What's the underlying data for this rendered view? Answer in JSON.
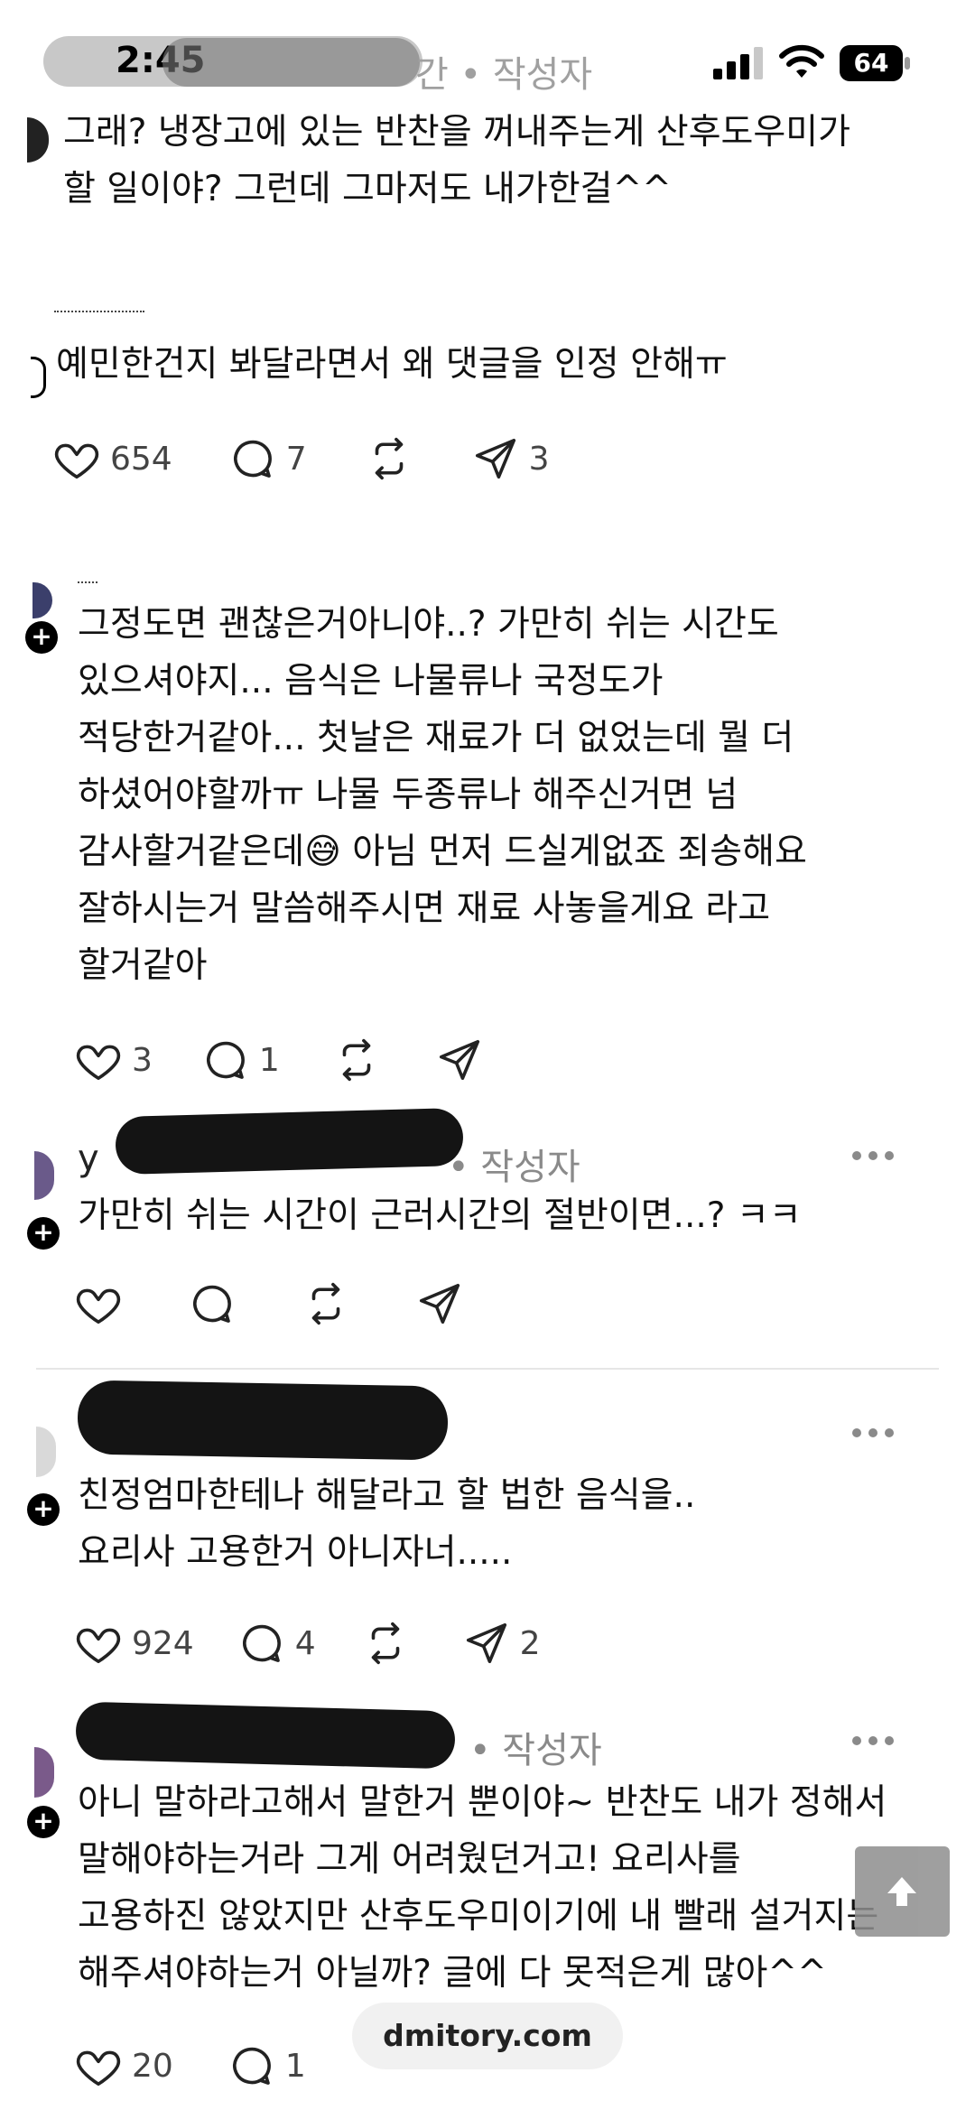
{
  "status_bar": {
    "time": "2:45",
    "battery": "64"
  },
  "comments": [
    {
      "meta_tail": "간 • 작성자",
      "lines": [
        "그래? 냉장고에 있는 반찬을 꺼내주는게 산후도우미가",
        "할 일이야? 그런데 그마저도 내가한걸^^"
      ]
    },
    {
      "lines": [
        "예민한건지 봐달라면서 왜 댓글을 인정 안해ㅠ"
      ],
      "likes": "654",
      "replies": "7",
      "shares": "3"
    },
    {
      "lines": [
        "그정도면 괜찮은거아니야..? 가만히 쉬는 시간도",
        "있으셔야지... 음식은 나물류나 국정도가",
        "적당한거같아... 첫날은 재료가 더 없었는데 뭘 더",
        "하셨어야할까ㅠ 나물 두종류나 해주신거면 넘",
        "감사할거같은데😅 아님 먼저 드실게없죠 죄송해요",
        "잘하시는거 말씀해주시면 재료 사놓을게요 라고",
        "할거같아"
      ],
      "likes": "3",
      "replies": "1"
    },
    {
      "author_visible": "y",
      "meta_tail": "• 작성자",
      "lines": [
        "가만히 쉬는 시간이 근러시간의 절반이면...? ㅋㅋ"
      ]
    },
    {
      "lines": [
        "친정엄마한테나 해달라고 할 법한 음식을..",
        "요리사 고용한거 아니자너....."
      ],
      "likes": "924",
      "replies": "4",
      "shares": "2"
    },
    {
      "meta_tail": "• 작성자",
      "lines": [
        "아니 말하라고해서 말한거 뿐이야~ 반찬도 내가 정해서",
        "말해야하는거라 그게 어려웠던거고! 요리사를",
        "고용하진 않았지만 산후도우미이기에 내 빨래 설거지는",
        "해주셔야하는거 아닐까? 글에 다 못적은게 많아^^"
      ],
      "likes": "20",
      "replies": "1"
    }
  ],
  "watermark": "dmitory.com",
  "icons": {
    "like": "heart-icon",
    "reply": "comment-bubble-icon",
    "repost": "repost-icon",
    "share": "send-icon",
    "more": "more-dots-icon",
    "scroll_top": "arrow-up-icon"
  }
}
